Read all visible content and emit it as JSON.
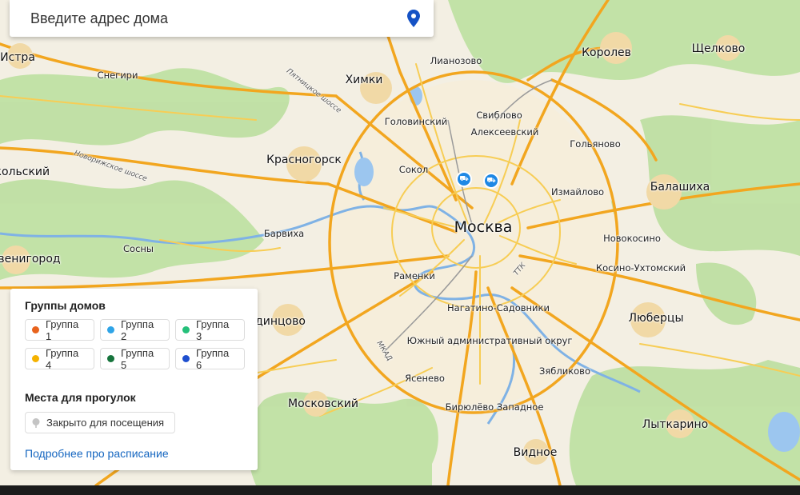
{
  "search": {
    "placeholder": "Введите адрес дома"
  },
  "map": {
    "labels": {
      "istra": "Истра",
      "snegiri": "Снегири",
      "khimki": "Химки",
      "lianozovo": "Лианозово",
      "korolev": "Королев",
      "shchelkovo": "Щелково",
      "golovinsky": "Головинский",
      "sviblovo": "Свиблово",
      "alekseevsky": "Алексеевский",
      "golyanovo": "Гольяново",
      "krasnogorsk": "Красногорск",
      "sokol": "Сокол",
      "izmailovo": "Измайлово",
      "balashikha": "Балашиха",
      "moskva": "Москва",
      "barvikha": "Барвиха",
      "novokosino": "Новокосино",
      "sosny": "Сосны",
      "ramenki": "Раменки",
      "kosino": "Косино-Ухтомский",
      "odintsovo": "Одинцово",
      "nagatino": "Нагатино-Садовники",
      "lyubertsy": "Люберцы",
      "yuzhny": "Южный административный округ",
      "yasenevo": "Ясенево",
      "zyablikovo": "Зябликово",
      "moskovsky": "Московский",
      "biryulevo": "Бирюлёво Западное",
      "lytkarino": "Лыткарино",
      "vidnoe": "Видное",
      "zvenigorod": "Звенигород",
      "nikolsky": "Никольский",
      "pyatnitskoe": "Пятницкое шоссе",
      "novorizhskoe": "Новорижское шоссе",
      "mkad": "МКАД",
      "ttk": "ТТК"
    }
  },
  "legend": {
    "groups_title": "Группы домов",
    "groups": [
      {
        "label": "Группа 1",
        "color": "#e8631d"
      },
      {
        "label": "Группа 2",
        "color": "#2fa4e7"
      },
      {
        "label": "Группа 3",
        "color": "#25c07a"
      },
      {
        "label": "Группа 4",
        "color": "#f5b200"
      },
      {
        "label": "Группа 5",
        "color": "#16743c"
      },
      {
        "label": "Группа 6",
        "color": "#1e4fcf"
      }
    ],
    "walks_title": "Места для прогулок",
    "closed_label": "Закрыто для посещения",
    "closed_color": "#c4c4c4",
    "more_link": "Подробнее про расписание"
  }
}
